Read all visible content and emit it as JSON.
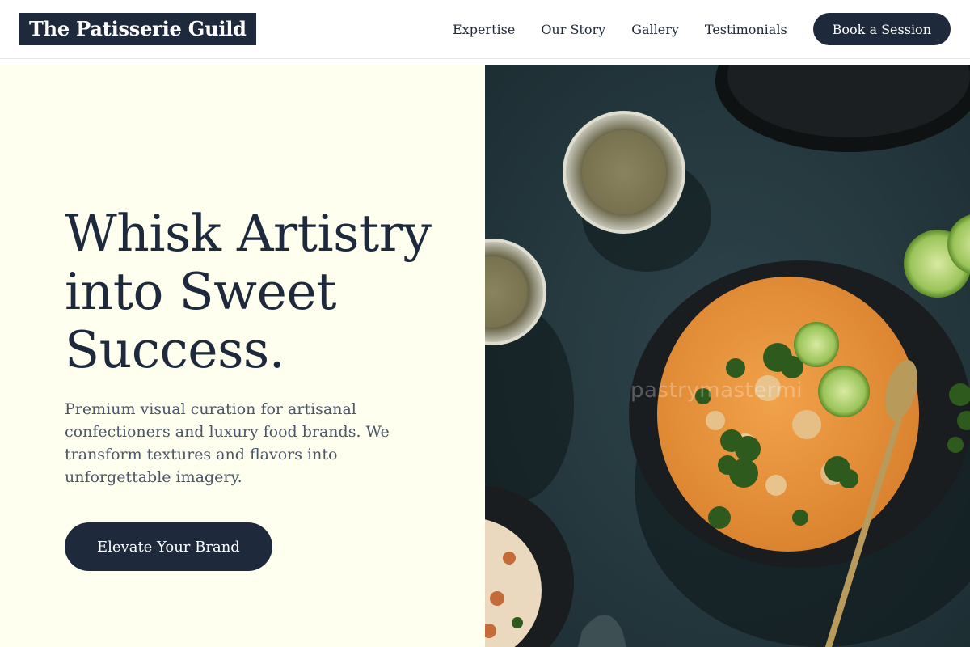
{
  "header": {
    "logo": "The Patisserie Guild",
    "nav": [
      "Expertise",
      "Our Story",
      "Gallery",
      "Testimonials"
    ],
    "cta_label": "Book a Session"
  },
  "hero": {
    "title": "Whisk Artistry into Sweet Success.",
    "description": "Premium visual curation for artisanal confectioners and luxury food brands. We transform textures and flavors into unforgettable imagery.",
    "cta_label": "Elevate Your Brand"
  },
  "image": {
    "watermark": "pastrymastermi",
    "colors": {
      "background": "#22353b",
      "curry": "#e9953a",
      "bowl": "#1a1d1f",
      "lime": "#9bc45a",
      "broccoli": "#2f5a1e"
    }
  },
  "theme": {
    "primary": "#1e293b",
    "hero_bg": "#fffff0",
    "text_muted": "#4a5568"
  }
}
